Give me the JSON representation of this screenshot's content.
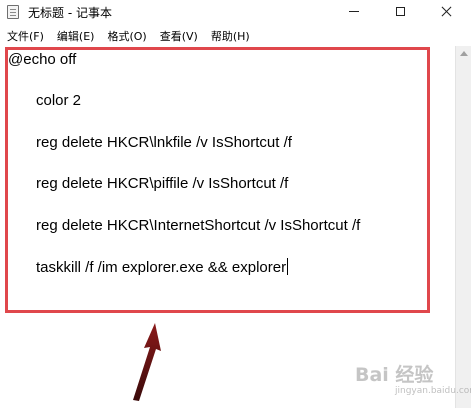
{
  "window": {
    "title": "无标题 - 记事本"
  },
  "menu": {
    "items": [
      "文件(F)",
      "编辑(E)",
      "格式(O)",
      "查看(V)",
      "帮助(H)"
    ]
  },
  "editor": {
    "lines": [
      "@echo off",
      "color 2",
      "reg delete HKCR\\lnkfile /v IsShortcut /f",
      "reg delete HKCR\\piffile /v IsShortcut /f",
      "reg delete HKCR\\InternetShortcut /v IsShortcut /f",
      "taskkill /f /im explorer.exe && explorer"
    ]
  },
  "annotation": {
    "box_color": "#e0474c",
    "arrow_color": "#8b1a1a"
  },
  "watermark": {
    "logo_text": "Bai 经验",
    "sub_text": "jingyan.baidu.com"
  },
  "icons": {
    "app": "notepad-icon",
    "minimize": "minimize-icon",
    "maximize": "maximize-icon",
    "close": "close-icon",
    "scroll_up": "scroll-up-arrow-icon"
  }
}
